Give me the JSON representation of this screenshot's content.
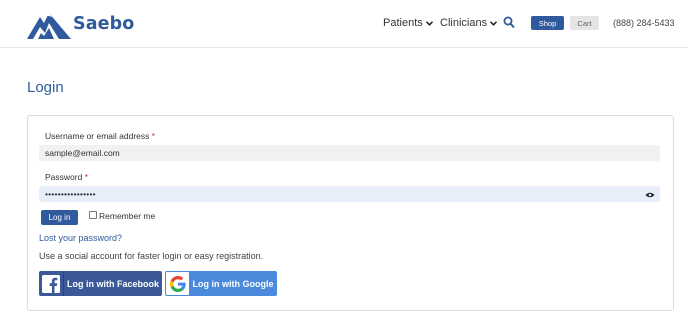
{
  "brand": {
    "name": "Saebo",
    "accent": "#2f5a9e"
  },
  "nav": {
    "patients": "Patients",
    "clinicians": "Clinicians",
    "shop": "Shop",
    "cart": "Cart",
    "phone": "(888) 284-5433",
    "search_icon": "search-icon"
  },
  "page": {
    "title": "Login"
  },
  "form": {
    "username_label": "Username or email address",
    "username_value": "sample@email.com",
    "password_label": "Password",
    "password_value": "••••••••••••••••",
    "required_mark": "*",
    "login_button": "Log in",
    "remember_label": "Remember me",
    "remember_checked": false,
    "lost_password": "Lost your password?",
    "social_text": "Use a social account for faster login or easy registration.",
    "facebook_button": "Log in with Facebook",
    "google_button": "Log in with Google"
  },
  "colors": {
    "facebook": "#3b5998",
    "google": "#4a89dc",
    "cart_bg": "#e5e5e5",
    "password_bg": "#e8eefa"
  }
}
